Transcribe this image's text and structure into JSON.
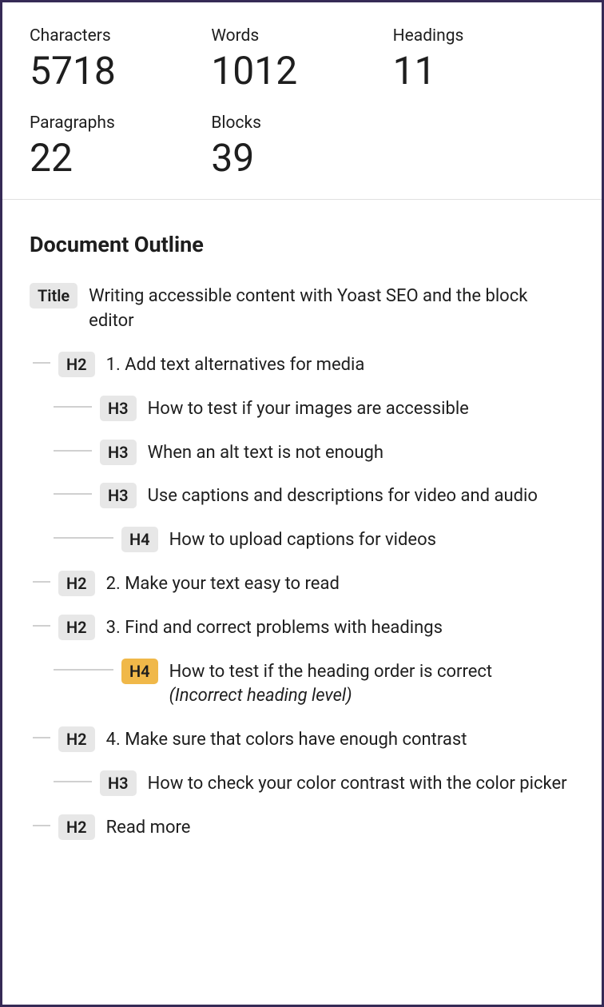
{
  "stats": {
    "characters_label": "Characters",
    "characters_value": "5718",
    "words_label": "Words",
    "words_value": "1012",
    "headings_label": "Headings",
    "headings_value": "11",
    "paragraphs_label": "Paragraphs",
    "paragraphs_value": "22",
    "blocks_label": "Blocks",
    "blocks_value": "39"
  },
  "outline": {
    "title": "Document Outline",
    "items": [
      {
        "level": "Title",
        "indent": 0,
        "text": "Writing accessible content with Yoast SEO and the block editor",
        "warn": false
      },
      {
        "level": "H2",
        "indent": 1,
        "text": "1. Add text alternatives for media",
        "warn": false
      },
      {
        "level": "H3",
        "indent": 2,
        "text": "How to test if your images are accessible",
        "warn": false
      },
      {
        "level": "H3",
        "indent": 2,
        "text": "When an alt text is not enough",
        "warn": false
      },
      {
        "level": "H3",
        "indent": 2,
        "text": "Use captions and descriptions for video and audio",
        "warn": false
      },
      {
        "level": "H4",
        "indent": 3,
        "text": "How to upload captions for videos",
        "warn": false
      },
      {
        "level": "H2",
        "indent": 1,
        "text": "2. Make your text easy to read",
        "warn": false
      },
      {
        "level": "H2",
        "indent": 1,
        "text": "3. Find and correct problems with headings",
        "warn": false
      },
      {
        "level": "H4",
        "indent": 3,
        "text": "How to test if the heading order is correct",
        "note": "(Incorrect heading level)",
        "warn": true
      },
      {
        "level": "H2",
        "indent": 1,
        "text": "4. Make sure that colors have enough contrast",
        "warn": false
      },
      {
        "level": "H3",
        "indent": 2,
        "text": "How to check your color contrast with the color picker",
        "warn": false
      },
      {
        "level": "H2",
        "indent": 1,
        "text": "Read more",
        "warn": false
      }
    ]
  }
}
